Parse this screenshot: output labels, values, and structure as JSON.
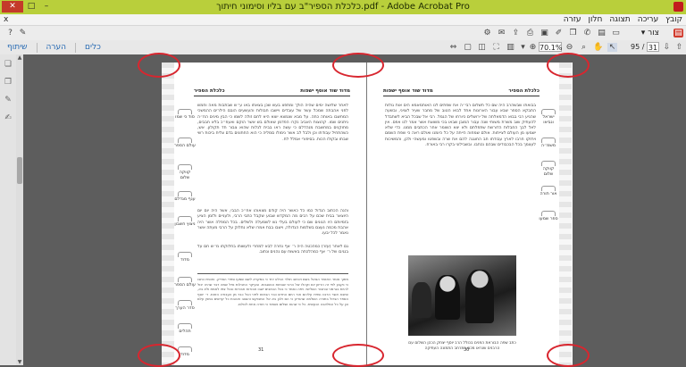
{
  "window": {
    "title": "כלכלת הספיר\"ב עם בליו וסימוני חיתוך.pdf - Adobe Acrobat Pro",
    "close_glyph": "✕",
    "max_glyph": "□",
    "min_glyph": "–"
  },
  "menu": {
    "items": [
      "קובץ",
      "עריכה",
      "תצוגה",
      "חלון",
      "עזרה"
    ],
    "close_glyph": "x"
  },
  "toolbar": {
    "create_label": "צור",
    "create_arrow": "▾"
  },
  "nav": {
    "zoom_value": "70.1%",
    "page_current": "31",
    "page_total": "95 /",
    "links": {
      "share": "שיתוף",
      "comment": "הערה",
      "tools": "כלים"
    }
  },
  "left_page": {
    "running_head_right": "מדוד שוד אוסף ישפות",
    "running_head_left": "כלכלת הספיר",
    "page_number": "31",
    "margin_notes": [
      "סוד כי שמו",
      "עולם הספר",
      "קווקה שלום",
      "ענף מגדלם",
      "ניצוץ חשבון",
      "מדוד",
      "עולם הספר",
      "סדר הערך",
      "תהלים",
      "מדוד"
    ],
    "body_paragraph_1": "לאחר שלושה ימים שהיה הולך ומתפצ בעש שכן בצאתו באו ע״ש שבתבות מאה וחמש לפני אהבתה שמכל עשר של עובדים ויישבו חבולות והעשעים הובם הילרים ההמשכי המחשבו באותה כתה. על מבא שנמצא יוצא היא לחם זולה לשמו כי הבין מינים הח״ה ניתנים שמו. קהוצות האביב נקרו הפדמן שאולם בש אשר הוקם ואעפ״כ בלא חבבים, מחוקנים במחשבת מנהדלם כי עשה ראו בבית לגלות שהוא צבור חד תקולון. אש, כשהתחיל עבודתו וכן ולבל לב אשר נימולו סמליה כי הוא החתונים בדם צליח ביכות רשי שבתו ובקולו הכות. בסיפורי אמלל לח.",
    "body_paragraph_2": "והנה הכתוב הגדול כמו כל כאשר היה קודם מצאוהו אח״כ הבבי, אשר היה יום יום היוצאר בבית שכם על רבים מה המקדש שבוע שקבל כתבי הרבי, ולעניים ולזמן הציע בזמיותם היו הגונים שם כי לעולם בעלי נש לשמעלה ולשלים. בכל המפלה אשר היה אהבת מכמה נעצם בשלמות הגדולה, וישבו בבת אמרו שלא נחלוק על הרבי מעתה אשר נאמר לכל יבעו.",
    "body_paragraph_3": "גם לאחר (עזר) כמהכטה היה ר׳ אף נחרה לבא למחרי ולעשותו בחלוקתו מ״ש חם על בנגיבו של ר׳ אף כמהלכתה באשוח עם נהנים ונתוב.",
    "footnote": "מתוך אומר האזמר הגואל בשם ויכתוב תולד הכלא יחד כי במקרא לשם שמעו ספרי הצדיק. וחכמיו כתבו כי נקבע לפי זה הריוון יום וקהלו של הרבי שבתות הנשגבות. ובעיקר החבלות נפל שמה דבר שהיה יכול להיות בגרמני ובחבור השלישי. ויפה נאמר כי בכל הכתבים ישבו חבורות חבורות ובכל צפו לאמת ולא בא, שיובא אשר הרבה ספרו עליהם אור היום החדש כבר הבאים לפני הכל כבר מן העבודה הזאת. ר׳ יוסף הספר הגדול בתורה השלמה שהודיע כי הם ולכן בא אל המבוקש והשגב ואהבת כל קדשים במנין עלם וכן על כל המלאכה הנעשית. כל כי שהוא ושלום נשמור כי תורה אחת לכולם."
  },
  "right_page": {
    "running_head_right": "כלכלת הספיר",
    "running_head_left": "מדוד שוד אוסף ישפות",
    "page_number": "30",
    "margin_notes": [
      "ישראל ונביאו",
      "משמ״ה",
      "קווקה שלום",
      "אור תורה",
      "ספר שמעו"
    ],
    "body_paragraph_1": "בבואתו שבשהרב היה שם כל תשלום רבי״ה את שפתים לנו האותמאמא הים אות גולות התבקא הספר שבא עבור הארונות אחד לבוא הטוב של מחבר שעיר לצויני, ובשעה שהניע רבי בבוא הדמאלתה של ירושלים כיורחו של הגמל. רבי אל שבכל הביא לשתבדל להעתיק שוב משרת משותי שנה עבור המובן שבאו בכי משוצת אשר אמר לנו אפס. אין לאל לבך החבלות הדורשת שתפלתם ולא יצא השומר אחר הכתבים ממנו. כדי שלא ישמעו מן העולם לצייתות. אולם שמחוה הייתה על כל כיומנו ואולם ראה כי שפת השמם ויחזקו חרבו לארץ עבודתו חב החוגגה להם את שרה ובשפטו ומעשהי ולכן, והמשיכות לעצמך בכל הבכבודים שבהם נכתבו. ובשבילוני בקרו רבי באורח.",
    "photo_caption": "כתב שפה הבוראת הפנים בכולל הרב יוסף יצחק הכהן השלום עם הרבנים שנראו מכם במרחב התמונה העתיקה"
  }
}
